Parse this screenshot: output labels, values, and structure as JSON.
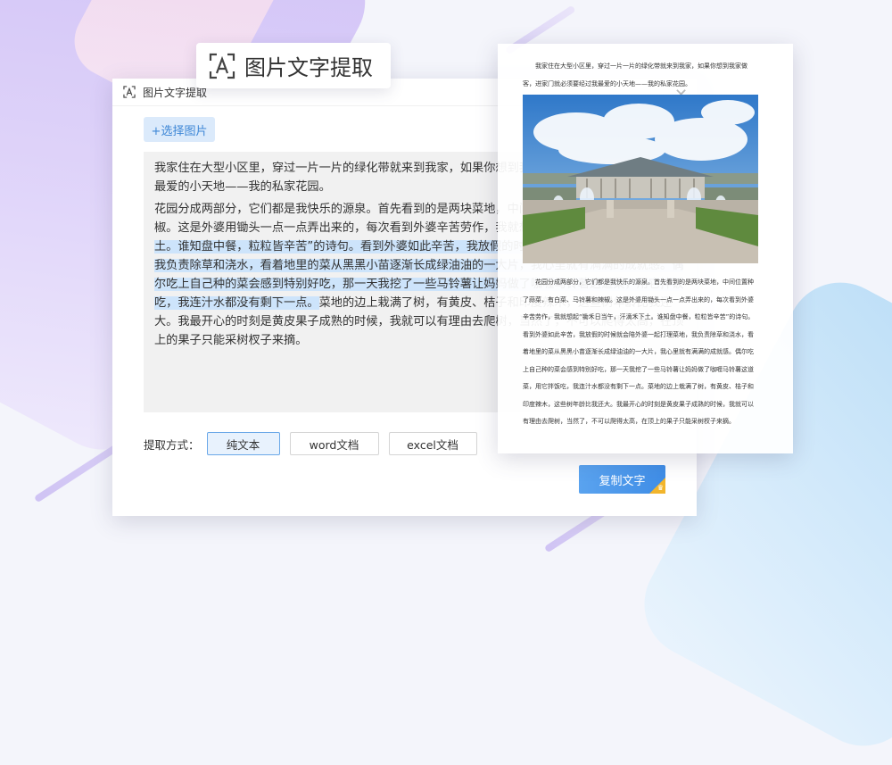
{
  "badge": {
    "title": "图片文字提取",
    "icon": "text-scan-icon"
  },
  "window": {
    "title": "图片文字提取",
    "pick_button": "+选择图片",
    "paragraphs": [
      {
        "segments": [
          {
            "text": "我家住在大型小区里，穿过一片一片的绿化带就来到我家，如果你想到我家做客，一定门必须要经过我最爱的小天地——我的私家花园。",
            "highlight": false
          }
        ]
      },
      {
        "segments": [
          {
            "text": "花园分成两部分，它们都是我快乐的源泉。首先看到的是两块菜地，中间位置种了蒜、菜、马铃薯和辣椒。这是外婆用锄头一点一点弄出来的，每次看到外婆辛苦劳作，我就想起",
            "highlight": false
          },
          {
            "text": "“锄禾日当午，汗滴禾下土。谁知盘中餐，粒粒皆辛苦”的诗句。看到外婆如此辛苦，我放假的时候就会陪外婆一起打理菜地，我负责除草和浇水，看着地里的菜从黑黑小苗逐渐长成绿油油的一大片，我心里就有满满的成就感。偶尔吃上自己种的菜会感到特别好吃，那一天我挖了一些马铃薯让妈妈做了咖喱马铃薯这道菜，用它拌饭吃，我连汁水都没有剩下一点。",
            "highlight": true
          },
          {
            "text": "菜地的边上栽满了树，有黄皮、桔子和印度辣木，这些树年龄比我还大。我最开心的时刻是黄皮果子成熟的时候，我就可以有理由去爬树，当然了，不可以爬得太高，在顶上的果子只能采树杈子来摘。",
            "highlight": false
          }
        ]
      }
    ],
    "mode_label": "提取方式：",
    "modes": [
      "纯文本",
      "word文档",
      "excel文档"
    ],
    "active_mode": "纯文本",
    "copy_button": "复制文字"
  },
  "document": {
    "top_text": "我家住在大型小区里，穿过一片一片的绿化带就来到我家，如果你想到我家做客，进家门就必须要经过我最爱的小天地——我的私家花园。",
    "body_text": "花园分成两部分，它们都是我快乐的源泉。首先看到的是两块菜地，中间位置种了蒜菜，有白菜、马铃薯和辣椒。这是外婆用锄头一点一点弄出来的，每次看到外婆辛苦劳作，我就想起“锄禾日当午，汗滴禾下土。谁知盘中餐，粒粒皆辛苦”的诗句。看到外婆如此辛苦，我放假的时候就会陪外婆一起打理菜地，我负责除草和浇水，看着地里的菜从黑黑小苗逐渐长成绿油油的一大片，我心里就有满满的成就感。偶尔吃上自己种的菜会感到特别好吃，那一天我挖了一些马铃薯让妈妈做了咖喱马铃薯这道菜，用它拌饭吃，我连汁水都没有剩下一点。菜地的边上栽满了树，有黄皮、桔子和印度辣木，这些树年龄比我还大。我最开心的时刻是黄皮果子成熟的时候，我就可以有理由去爬树，当然了，不可以爬得太高，在顶上的果子只能采树杈子来摘。",
    "photo": "museum-fountain-photo"
  },
  "colors": {
    "accent": "#3f8de6",
    "highlight": "#cde4fb",
    "vip": "#f2b52c"
  }
}
